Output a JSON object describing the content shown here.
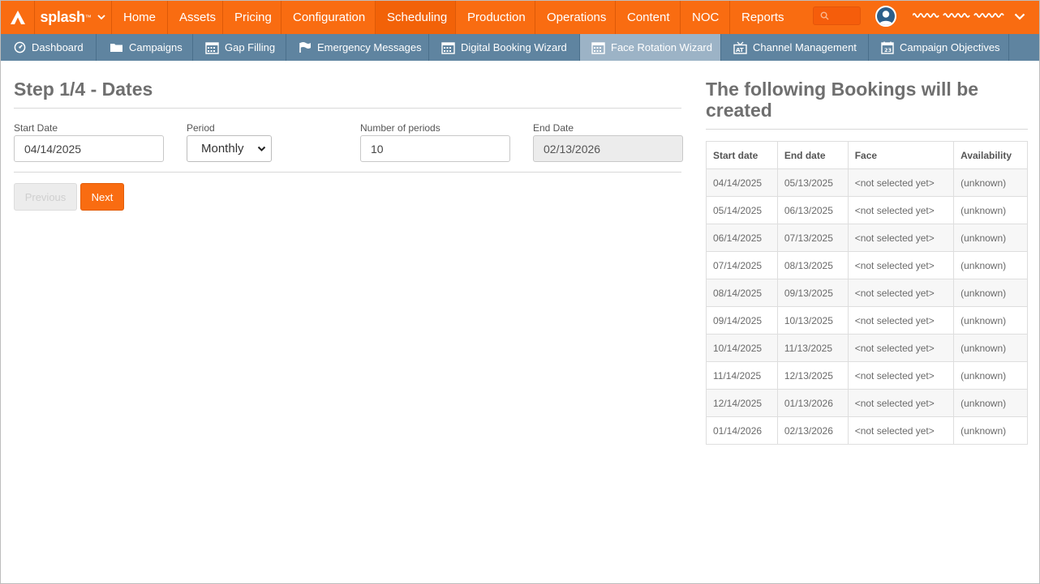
{
  "brand": {
    "name": "splash",
    "tm": "™"
  },
  "topnav": {
    "items": [
      {
        "label": "Home"
      },
      {
        "label": "Assets"
      },
      {
        "label": "Pricing"
      },
      {
        "label": "Configuration"
      },
      {
        "label": "Scheduling"
      },
      {
        "label": "Production"
      },
      {
        "label": "Operations"
      },
      {
        "label": "Content"
      },
      {
        "label": "NOC"
      },
      {
        "label": "Reports"
      }
    ]
  },
  "subnav": {
    "items": [
      {
        "label": "Dashboard"
      },
      {
        "label": "Campaigns"
      },
      {
        "label": "Gap Filling"
      },
      {
        "label": "Emergency Messages"
      },
      {
        "label": "Digital Booking Wizard"
      },
      {
        "label": "Face Rotation Wizard"
      },
      {
        "label": "Channel Management"
      },
      {
        "label": "Campaign Objectives"
      }
    ]
  },
  "step": {
    "title": "Step 1/4 - Dates",
    "start_date_label": "Start Date",
    "start_date_value": "04/14/2025",
    "period_label": "Period",
    "period_value": "Monthly",
    "periods_label": "Number of periods",
    "periods_value": "10",
    "end_date_label": "End Date",
    "end_date_value": "02/13/2026",
    "prev_label": "Previous",
    "next_label": "Next"
  },
  "bookings": {
    "title": "The following Bookings will be created",
    "headers": [
      "Start date",
      "End date",
      "Face",
      "Availability"
    ],
    "rows": [
      [
        "04/14/2025",
        "05/13/2025",
        "<not selected yet>",
        "(unknown)"
      ],
      [
        "05/14/2025",
        "06/13/2025",
        "<not selected yet>",
        "(unknown)"
      ],
      [
        "06/14/2025",
        "07/13/2025",
        "<not selected yet>",
        "(unknown)"
      ],
      [
        "07/14/2025",
        "08/13/2025",
        "<not selected yet>",
        "(unknown)"
      ],
      [
        "08/14/2025",
        "09/13/2025",
        "<not selected yet>",
        "(unknown)"
      ],
      [
        "09/14/2025",
        "10/13/2025",
        "<not selected yet>",
        "(unknown)"
      ],
      [
        "10/14/2025",
        "11/13/2025",
        "<not selected yet>",
        "(unknown)"
      ],
      [
        "11/14/2025",
        "12/13/2025",
        "<not selected yet>",
        "(unknown)"
      ],
      [
        "12/14/2025",
        "01/13/2026",
        "<not selected yet>",
        "(unknown)"
      ],
      [
        "01/14/2026",
        "02/13/2026",
        "<not selected yet>",
        "(unknown)"
      ]
    ]
  },
  "colors": {
    "brand_orange": "#f96c11",
    "subnav_blue": "#5f84a0",
    "subnav_active": "#9cb3c6"
  }
}
